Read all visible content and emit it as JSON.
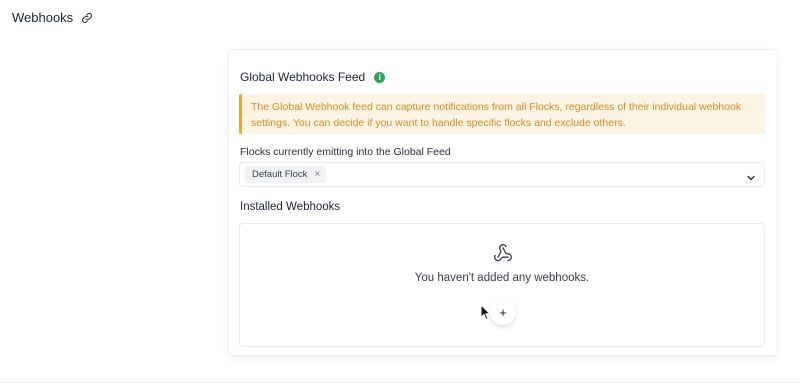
{
  "header": {
    "title": "Webhooks",
    "link_icon": "link-icon"
  },
  "feed": {
    "title": "Global Webhooks Feed",
    "info_icon": "info-icon",
    "info_glyph": "i",
    "notice": "The Global Webhook feed can capture notifications from all Flocks, regardless of their individual webhook settings. You can decide if you want to handle specific flocks and exclude others.",
    "emitting_label": "Flocks currently emitting into the Global Feed",
    "selected_flocks": [
      "Default Flock"
    ],
    "chip_remove_glyph": "×",
    "dropdown_icon": "chevron-down-icon"
  },
  "installed": {
    "title": "Installed Webhooks",
    "empty_icon": "webhook-icon",
    "empty_text": "You haven't added any webhooks.",
    "add_glyph": "+"
  },
  "colors": {
    "notice_bg": "#fdf4e3",
    "notice_border": "#f1a33b",
    "notice_text": "#d8892a",
    "info_green": "#2ea35b"
  }
}
